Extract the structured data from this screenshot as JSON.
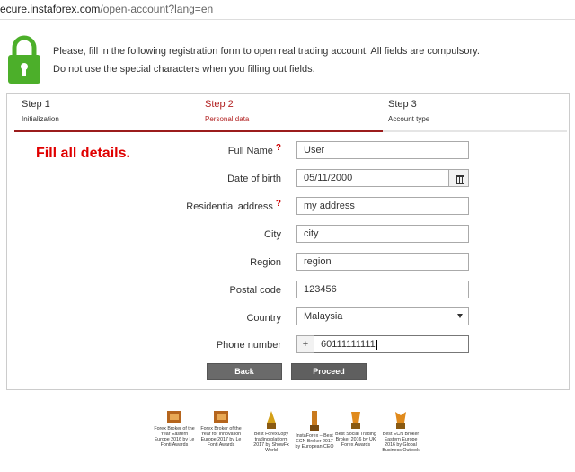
{
  "browser": {
    "url_host": "ecure.instaforex.com",
    "url_path": "/open-account?lang=en"
  },
  "intro": {
    "line1": "Please, fill in the following registration form to open real trading account. All fields are compulsory.",
    "line2": "Do not use the special characters when you filling out fields."
  },
  "steps": [
    {
      "label": "Step 1",
      "sub": "Initialization"
    },
    {
      "label": "Step 2",
      "sub": "Personal data"
    },
    {
      "label": "Step 3",
      "sub": "Account type"
    }
  ],
  "progress_fraction": 0.667,
  "annotation": "Fill all details.",
  "form": {
    "full_name": {
      "label": "Full Name",
      "value": "User"
    },
    "dob": {
      "label": "Date of birth",
      "value": "05/11/2000"
    },
    "address": {
      "label": "Residential address",
      "value": "my address"
    },
    "city": {
      "label": "City",
      "value": "city"
    },
    "region": {
      "label": "Region",
      "value": "region"
    },
    "postal": {
      "label": "Postal code",
      "value": "123456"
    },
    "country": {
      "label": "Country",
      "value": "Malaysia"
    },
    "phone": {
      "label": "Phone number",
      "prefix": "+",
      "value": "60111111111"
    },
    "required_mark": "?"
  },
  "buttons": {
    "back": "Back",
    "proceed": "Proceed"
  },
  "awards": [
    {
      "caption": "Forex Broker of the Year Eastern Europe 2016 by Le Fonti Awards"
    },
    {
      "caption": "Forex Broker of the Year for Innovation Europe 2017 by Le Fonti Awards"
    },
    {
      "caption": "Best ForexCopy trading platform 2017 by ShowFx World"
    },
    {
      "caption": "InstaForex – Best ECN Broker 2017 by European CEO"
    },
    {
      "caption": "Best Social Trading Broker 2016 by UK Forex Awards"
    },
    {
      "caption": "Best ECN Broker Eastern Europe 2016 by Global Business Outlook"
    }
  ],
  "colors": {
    "lock": "#4caf2a",
    "accent": "#9b1c1c",
    "annotation": "#e00000"
  }
}
